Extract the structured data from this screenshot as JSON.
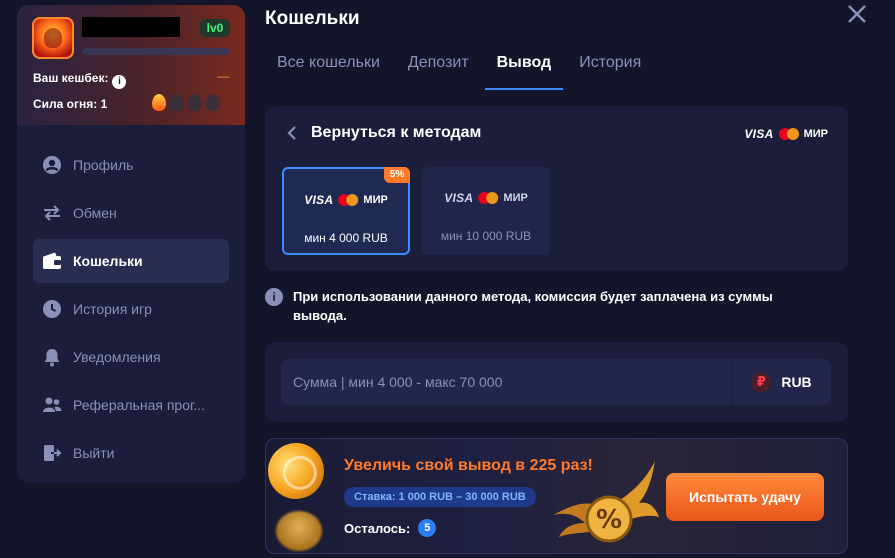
{
  "profile": {
    "level": "lv0",
    "xp_progress": 0,
    "cashback_label": "Ваш кешбек:",
    "cashback_info_icon": "i",
    "cashback_value": "—",
    "fire_label": "Сила огня: 1",
    "flames_total": 4,
    "flames_active": 1,
    "icons": [
      "avatar",
      "info-icon",
      "flame-icon"
    ]
  },
  "sidebar": {
    "items": [
      {
        "label": "Профиль",
        "icon": "user-icon",
        "active": false
      },
      {
        "label": "Обмен",
        "icon": "exchange-icon",
        "active": false
      },
      {
        "label": "Кошельки",
        "icon": "wallet-icon",
        "active": true
      },
      {
        "label": "История игр",
        "icon": "history-icon",
        "active": false
      },
      {
        "label": "Уведомления",
        "icon": "bell-icon",
        "active": false
      },
      {
        "label": "Реферальная прог...",
        "icon": "users-icon",
        "active": false
      },
      {
        "label": "Выйти",
        "icon": "logout-icon",
        "active": false
      }
    ]
  },
  "header": {
    "title": "Кошельки",
    "close_icon": "close-icon"
  },
  "tabs": [
    {
      "label": "Все кошельки",
      "active": false
    },
    {
      "label": "Депозит",
      "active": false
    },
    {
      "label": "Вывод",
      "active": true
    },
    {
      "label": "История",
      "active": false
    }
  ],
  "methods_card": {
    "back_label": "Вернуться к методам",
    "logos": {
      "visa": "VISA",
      "mir": "МИР"
    },
    "methods": [
      {
        "min_label": "мин 4 000 RUB",
        "badge": "5%",
        "selected": true
      },
      {
        "min_label": "мин 10 000 RUB",
        "badge": "",
        "selected": false
      }
    ]
  },
  "notice": {
    "icon": "i",
    "text": "При использовании данного метода, комиссия будет заплачена из суммы вывода."
  },
  "amount": {
    "placeholder": "Сумма | мин 4 000 - макс 70 000",
    "value": "",
    "currency_symbol": "₽",
    "currency_label": "RUB"
  },
  "promo": {
    "title": "Увеличь свой вывод в 225 раз!",
    "stake_label": "Ставка: 1 000 RUB – 30 000 RUB",
    "remaining_label": "Осталось:",
    "remaining_count": "5",
    "button_label": "Испытать удачу",
    "badge_symbol": "%"
  },
  "colors": {
    "accent_blue": "#3a8cff",
    "accent_orange": "#ff7a2a",
    "level_green": "#4cf07a",
    "background": "#13152b",
    "panel": "#1b1d3a"
  }
}
